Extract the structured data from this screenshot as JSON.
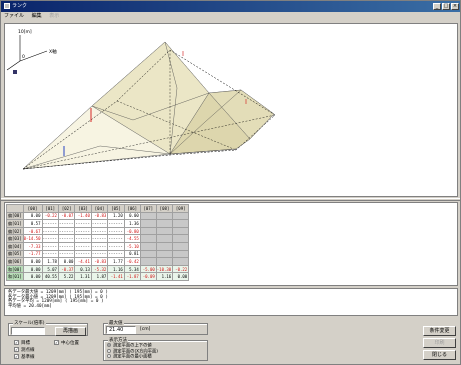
{
  "window": {
    "title": "ランク"
  },
  "menu": [
    {
      "label": "ファイル",
      "enabled": true
    },
    {
      "label": "編集",
      "enabled": true
    },
    {
      "label": "表示",
      "enabled": false
    }
  ],
  "view3d": {
    "axis_z_label": "10[m]",
    "axis_x_label": "X軸",
    "axis_origin_label": "0"
  },
  "table": {
    "headers": [
      "",
      "[00]",
      "[01]",
      "[02]",
      "[03]",
      "[04]",
      "[05]",
      "[06]",
      "[07]",
      "[08]",
      "[09]"
    ],
    "rows": [
      {
        "label": "偏[00]",
        "cells": [
          "0.00",
          "-0.22",
          "-0.07",
          "-1.40",
          "-0.83",
          "1.20",
          "0.00",
          "",
          "",
          ""
        ]
      },
      {
        "label": "偏[01]",
        "cells": [
          "0.57",
          "------",
          "------",
          "------",
          "------",
          "------",
          "1.36",
          "",
          "",
          ""
        ]
      },
      {
        "label": "偏[02]",
        "cells": [
          "-0.67",
          "------",
          "------",
          "------",
          "------",
          "------",
          "-0.80",
          "",
          "",
          ""
        ]
      },
      {
        "label": "偏[03]",
        "cells": [
          "0-14.50",
          "------",
          "------",
          "------",
          "------",
          "------",
          "-4.55",
          "",
          "",
          ""
        ]
      },
      {
        "label": "偏[04]",
        "cells": [
          "-7.33",
          "------",
          "------",
          "------",
          "------",
          "------",
          "-5.10",
          "",
          "",
          ""
        ]
      },
      {
        "label": "偏[05]",
        "cells": [
          "-1.77",
          "------",
          "------",
          "------",
          "------",
          "------",
          "0.81",
          "",
          "",
          ""
        ]
      },
      {
        "label": "偏[06]",
        "cells": [
          "0.00",
          "1.78",
          "0.00",
          "-4.41",
          "-0.83",
          "1.77",
          "-0.42",
          "",
          "",
          ""
        ]
      },
      {
        "label": "和[00]",
        "cells": [
          "0.00",
          "5.07",
          "-0.37",
          "0.13",
          "-5.32",
          "1.16",
          "5.34",
          "-5.00",
          "-10.30",
          "-0.22"
        ]
      },
      {
        "label": "和[01]",
        "cells": [
          "0.00",
          "40.55",
          "5.22",
          "1.31",
          "1.87",
          "-1.41",
          "-1.87",
          "-0.09",
          "1.16",
          "0.00"
        ]
      }
    ]
  },
  "info_lines": [
    "各データ最大値 =   1209[mm] ( 195[mm] = 0 )",
    "各データ最小値 =   1209[mm] ( 195[mm] = 0 )",
    "各データ平均 =     1209[mm] ( 195[mm] = 0 )",
    "平均値 = 20.40[mm]"
  ],
  "scale_group": {
    "legend": "スケール(倍率)",
    "value": "",
    "redraw_button": "再描画"
  },
  "checkboxes": [
    {
      "label": "目標",
      "checked": true
    },
    {
      "label": "中心位置",
      "checked": true
    },
    {
      "label": "測点線",
      "checked": true
    },
    {
      "label": "基準線",
      "checked": true
    }
  ],
  "height_group": {
    "legend": "最大値",
    "value": "21.40",
    "unit": "[cm]"
  },
  "display_group": {
    "legend": "表示方法",
    "options": [
      {
        "label": "測定平面の上下の値",
        "selected": true
      },
      {
        "label": "測定平面の(X方向平面)",
        "selected": false
      },
      {
        "label": "測定平面の最小面積",
        "selected": false
      }
    ]
  },
  "buttons": {
    "calc": "条件変更",
    "print": "印刷",
    "close": "閉じる"
  }
}
